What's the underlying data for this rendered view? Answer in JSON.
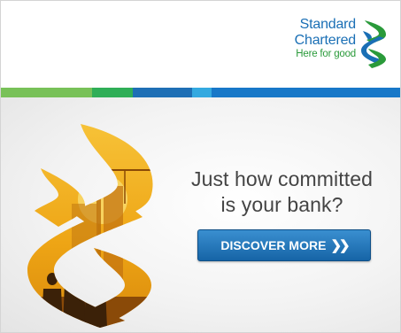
{
  "brand": {
    "name_line1": "Standard",
    "name_line2": "Chartered",
    "tagline": "Here for good"
  },
  "headline": {
    "line1": "Just how committed",
    "line2": "is your bank?"
  },
  "cta": {
    "label": "DISCOVER MORE",
    "icon": "double-chevron-right-icon"
  },
  "colors": {
    "brand_blue": "#1a6fb5",
    "brand_green": "#2a9a3a",
    "cta_blue": "#1664a6",
    "emblem_gold": "#f2b10a",
    "stripe": [
      "#78c158",
      "#2fae57",
      "#1e6fb5",
      "#34a9e0",
      "#1878c8"
    ]
  }
}
